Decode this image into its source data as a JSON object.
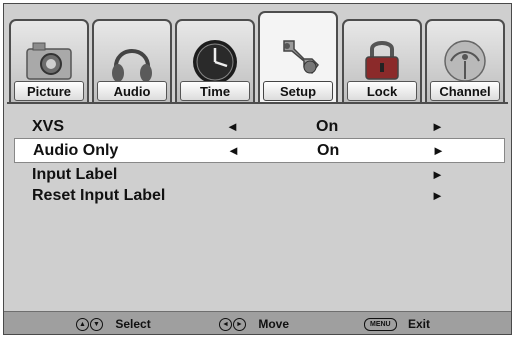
{
  "tabs": [
    {
      "label": "Picture",
      "icon": "camera-icon"
    },
    {
      "label": "Audio",
      "icon": "headphones-icon"
    },
    {
      "label": "Time",
      "icon": "clock-icon"
    },
    {
      "label": "Setup",
      "icon": "wrench-icon",
      "active": true
    },
    {
      "label": "Lock",
      "icon": "padlock-icon"
    },
    {
      "label": "Channel",
      "icon": "satellite-dish-icon"
    }
  ],
  "menu": {
    "items": [
      {
        "label": "XVS",
        "value": "On",
        "left_arrow": "◄",
        "right_arrow": "►"
      },
      {
        "label": "Audio Only",
        "value": "On",
        "left_arrow": "◄",
        "right_arrow": "►",
        "selected": true
      },
      {
        "label": "Input Label",
        "value": "",
        "left_arrow": "",
        "right_arrow": "►"
      },
      {
        "label": "Reset Input Label",
        "value": "",
        "left_arrow": "",
        "right_arrow": "►"
      }
    ]
  },
  "footer": {
    "select_label": "Select",
    "move_label": "Move",
    "menu_key": "MENU",
    "exit_label": "Exit",
    "up_glyph": "▲",
    "down_glyph": "▼",
    "left_glyph": "◄",
    "right_glyph": "►"
  },
  "colors": {
    "panel": "#cfcfcf",
    "footer": "#9f9f9f",
    "highlight": "#ffffff"
  }
}
